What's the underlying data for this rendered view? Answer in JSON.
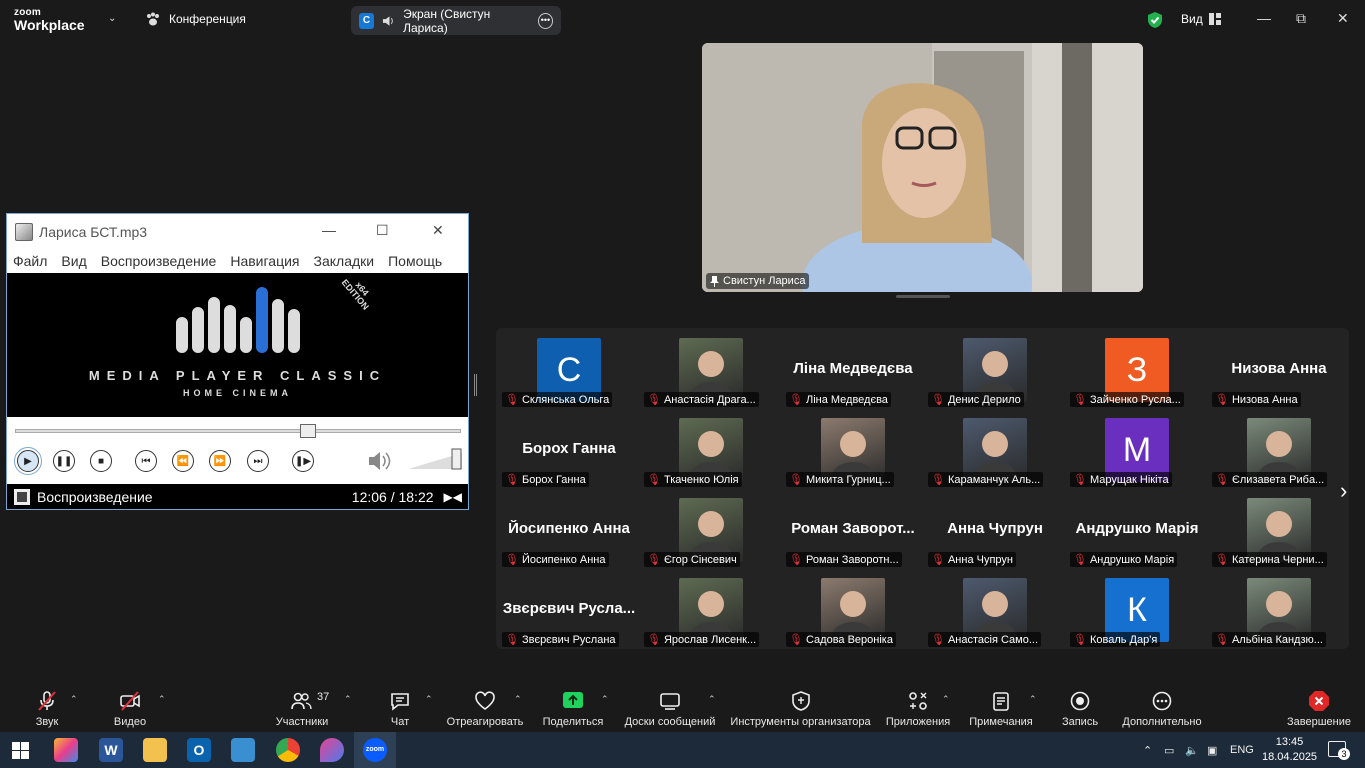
{
  "zoom": {
    "logo_line1": "zoom",
    "logo_line2": "Workplace",
    "conference_label": "Конференция",
    "screen_share_label": "Экран (Свистун Лариса)",
    "screen_share_badge": "C",
    "view_label": "Вид",
    "accent_color": "#0b5cff"
  },
  "presenter": {
    "name": "Свистун Лариса"
  },
  "media_player": {
    "title": "Лариса БСТ.mp3",
    "menu": [
      "Файл",
      "Вид",
      "Воспроизведение",
      "Навигация",
      "Закладки",
      "Помощь"
    ],
    "logo_main": "MEDIA PLAYER CLASSIC",
    "logo_sub": "HOME CINEMA",
    "edition_line1": "x64",
    "edition_line2": "EDITION",
    "status": "Воспроизведение",
    "time": "12:06 / 18:22",
    "progress": 0.66
  },
  "participants": [
    {
      "display": "avatar",
      "letter": "С",
      "color": "#0e5fb0",
      "label": "Склянська Ольга"
    },
    {
      "display": "photo",
      "label": "Анастасія Драга..."
    },
    {
      "display": "name",
      "big": "Ліна Медведєва",
      "label": "Ліна Медведєва"
    },
    {
      "display": "photo",
      "label": "Денис Дерило"
    },
    {
      "display": "avatar",
      "letter": "З",
      "color": "#f05a23",
      "label": "Зайченко Русла..."
    },
    {
      "display": "name",
      "big": "Низова Анна",
      "label": "Низова Анна"
    },
    {
      "display": "name",
      "big": "Борох Ганна",
      "label": "Борох Ганна"
    },
    {
      "display": "photo",
      "label": "Ткаченко Юлія"
    },
    {
      "display": "photo",
      "label": "Микита Гурниц..."
    },
    {
      "display": "photo",
      "label": "Караманчук Аль..."
    },
    {
      "display": "avatar",
      "letter": "М",
      "color": "#6b2fbf",
      "label": "Марущак Нікіта"
    },
    {
      "display": "photo",
      "label": "Єлизавета Рибa..."
    },
    {
      "display": "name",
      "big": "Йосипенко Анна",
      "label": "Йосипенко Анна"
    },
    {
      "display": "photo",
      "label": "Єгор Сінсевич"
    },
    {
      "display": "name",
      "big": "Роман Заворот...",
      "label": "Роман Заворотн..."
    },
    {
      "display": "name",
      "big": "Анна Чупрун",
      "label": "Анна Чупрун"
    },
    {
      "display": "name",
      "big": "Андрушко Марія",
      "label": "Андрушко Марія"
    },
    {
      "display": "photo",
      "label": "Катерина Черни..."
    },
    {
      "display": "name",
      "big": "Звєрєвич Русла...",
      "label": "Звєрєвич Руслана"
    },
    {
      "display": "photo",
      "label": "Ярослав Лисенк..."
    },
    {
      "display": "photo",
      "label": "Садова Вероніка"
    },
    {
      "display": "photo",
      "label": "Анастасія Само..."
    },
    {
      "display": "avatar",
      "letter": "К",
      "color": "#1570d0",
      "label": "Коваль Дар'я"
    },
    {
      "display": "photo",
      "label": "Альбіна Кандзю..."
    }
  ],
  "toolbar": {
    "audio": "Звук",
    "video": "Видео",
    "participants": "Участники",
    "participants_count": "37",
    "chat": "Чат",
    "react": "Отреагировать",
    "share": "Поделиться",
    "whiteboards": "Доски сообщений",
    "host_tools": "Инструменты организатора",
    "apps": "Приложения",
    "notes": "Примечания",
    "record": "Запись",
    "more": "Дополнительно",
    "end": "Завершение"
  },
  "taskbar": {
    "language": "ENG",
    "time": "13:45",
    "date": "18.04.2025",
    "notifications": "3"
  }
}
